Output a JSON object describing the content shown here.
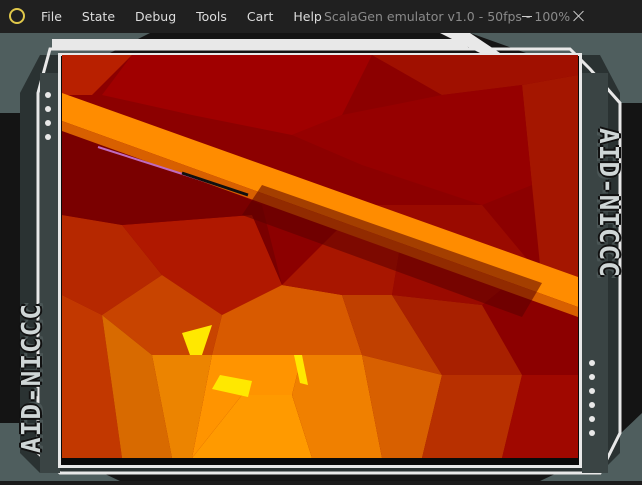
{
  "window": {
    "title": "ScalaGen emulator v1.0 - 50fps - 100%",
    "app_icon": "circle-logo-icon"
  },
  "menu": [
    {
      "id": "file",
      "label": "File"
    },
    {
      "id": "state",
      "label": "State"
    },
    {
      "id": "debug",
      "label": "Debug"
    },
    {
      "id": "tools",
      "label": "Tools"
    },
    {
      "id": "cart",
      "label": "Cart"
    },
    {
      "id": "help",
      "label": "Help"
    }
  ],
  "controls": {
    "minimize_icon": "minimize-icon",
    "close_icon": "close-icon"
  },
  "frame": {
    "left_text": "AID-NICCC",
    "right_text": "AID-NICCC",
    "colors": {
      "panel": "#4f5e5e",
      "border": "#e8e8e8",
      "dark": "#111111"
    }
  },
  "game": {
    "scene": "polygon-tunnel",
    "palette": [
      "#8c0000",
      "#a00000",
      "#c03000",
      "#e06000",
      "#ff8a00",
      "#ffb000",
      "#ffe800"
    ]
  }
}
